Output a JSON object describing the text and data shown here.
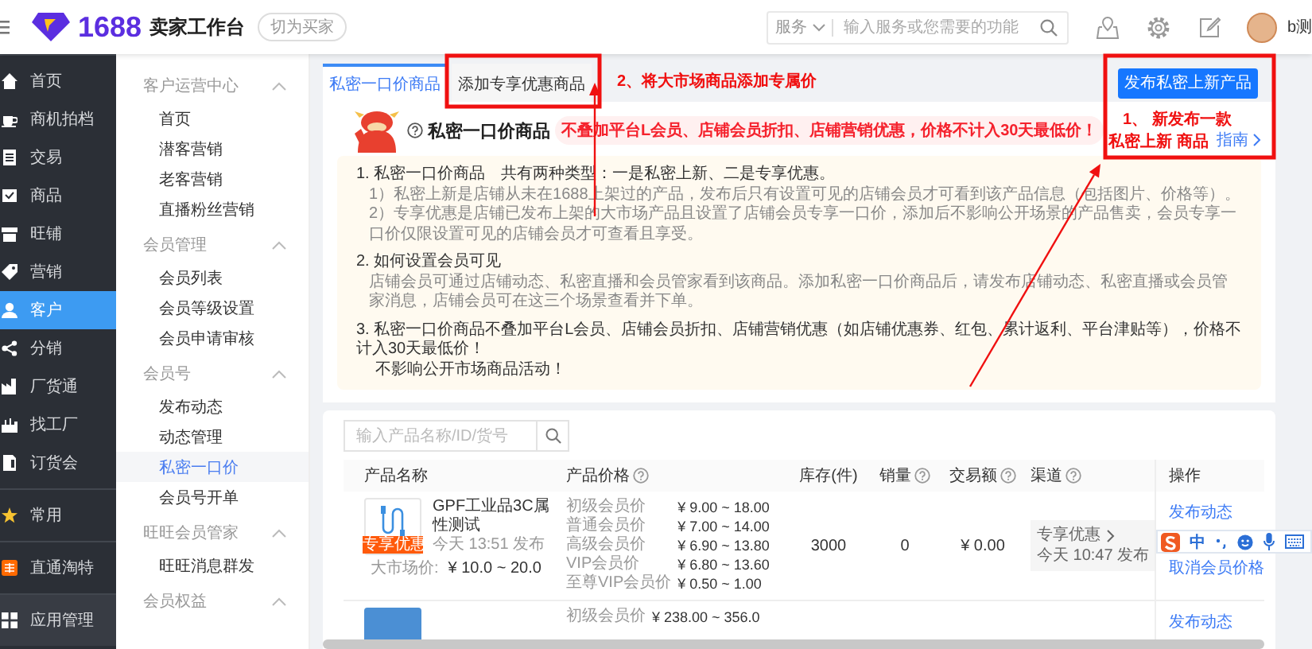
{
  "topbar": {
    "brand": "1688",
    "title": "卖家工作台",
    "switch_button": "切为买家",
    "search": {
      "scope": "服务",
      "placeholder": "输入服务或您需要的功能"
    },
    "user_name": "b测"
  },
  "nav": [
    {
      "items": [
        {
          "label": "首页",
          "selected": false
        },
        {
          "label": "商机拍档",
          "selected": false
        },
        {
          "label": "交易",
          "selected": false
        },
        {
          "label": "商品",
          "selected": false
        },
        {
          "label": "旺铺",
          "selected": false
        },
        {
          "label": "营销",
          "selected": false
        },
        {
          "label": "客户",
          "selected": true
        },
        {
          "label": "分销",
          "selected": false
        },
        {
          "label": "厂货通",
          "selected": false
        },
        {
          "label": "找工厂",
          "selected": false
        },
        {
          "label": "订货会",
          "selected": false
        }
      ]
    },
    {
      "items": [
        {
          "label": "常用",
          "selected": false
        }
      ]
    },
    {
      "items": [
        {
          "label": "直通淘特",
          "selected": false
        }
      ]
    },
    {
      "items": [
        {
          "label": "应用管理",
          "selected": false
        }
      ]
    }
  ],
  "subnav": [
    {
      "title": "客户运营中心",
      "expanded": true,
      "items": [
        {
          "label": "首页",
          "selected": false
        },
        {
          "label": "潜客营销",
          "selected": false
        },
        {
          "label": "老客营销",
          "selected": false
        },
        {
          "label": "直播粉丝营销",
          "selected": false
        }
      ]
    },
    {
      "title": "会员管理",
      "expanded": true,
      "items": [
        {
          "label": "会员列表",
          "selected": false
        },
        {
          "label": "会员等级设置",
          "selected": false
        },
        {
          "label": "会员申请审核",
          "selected": false
        }
      ]
    },
    {
      "title": "会员号",
      "expanded": true,
      "items": [
        {
          "label": "发布动态",
          "selected": false
        },
        {
          "label": "动态管理",
          "selected": false
        },
        {
          "label": "私密一口价",
          "selected": true
        },
        {
          "label": "会员号开单",
          "selected": false
        }
      ]
    },
    {
      "title": "旺旺会员管家",
      "expanded": true,
      "items": [
        {
          "label": "旺旺消息群发",
          "selected": false
        }
      ]
    },
    {
      "title": "会员权益",
      "expanded": true
    }
  ],
  "tabs": [
    {
      "label": "私密一口价商品",
      "selected": true
    },
    {
      "label": "添加专享优惠商品",
      "selected": false
    }
  ],
  "publish_button": "发布私密上新产品",
  "intro": {
    "title": "私密一口价商品",
    "notice": "不叠加平台L会员、店铺会员折扣、店铺营销优惠，价格不计入30天最低价！",
    "guide_link": "指南",
    "sections": [
      {
        "kind": "explain",
        "heading": "1. 私密一口价商品　共有两种类型：一是私密上新、二是专享优惠。",
        "lines": [
          "1）私密上新是店铺从未在1688上架过的产品，发布后只有设置可见的店铺会员才可看到该产品信息（包括图片、价格等）。",
          "2）专享优惠是店铺已发布上架的大市场产品且设置了店铺会员专享一口价，添加后不影响公开场景的产品售卖，会员专享一口价仅限设置可见的店铺会员才可查看且享受。"
        ]
      },
      {
        "kind": "explain",
        "heading": "2. 如何设置会员可见",
        "lines": [
          "店铺会员可通过店铺动态、私密直播和会员管家看到该商品。添加私密一口价商品后，请发布店铺动态、私密直播或会员管家消息，店铺会员可在这三个场景查看并下单。"
        ]
      },
      {
        "kind": "note",
        "heading": "3. 私密一口价商品不叠加平台L会员、店铺会员折扣、店铺营销优惠（如店铺优惠券、红包、累计返利、平台津贴等），价格不计入30天最低价！",
        "lines": [
          "不影响公开市场商品活动！"
        ]
      }
    ]
  },
  "product_search": {
    "placeholder": "输入产品名称/ID/货号"
  },
  "table": {
    "columns": [
      {
        "label": "产品名称",
        "help": false
      },
      {
        "label": "产品价格",
        "help": true
      },
      {
        "label": "库存(件)",
        "help": false
      },
      {
        "label": "销量",
        "help": true
      },
      {
        "label": "交易额",
        "help": true
      },
      {
        "label": "渠道",
        "help": true
      },
      {
        "label": "操作",
        "help": false
      }
    ],
    "rows": [
      {
        "name": "GPF工业品3C属性测试",
        "tag": "专享优惠",
        "published": "今天 13:51 发布",
        "market_label": "大市场价:",
        "market_price": "¥ 10.0 ~ 20.0",
        "prices": [
          {
            "tier": "初级会员价",
            "price": "¥ 9.00 ~ 18.00"
          },
          {
            "tier": "普通会员价",
            "price": "¥ 7.00 ~ 14.00"
          },
          {
            "tier": "高级会员价",
            "price": "¥ 6.90 ~ 13.80"
          },
          {
            "tier": "VIP会员价",
            "price": "¥ 6.80 ~ 13.60"
          },
          {
            "tier": "至尊VIP会员价",
            "price": "¥ 0.50 ~ 1.00"
          }
        ],
        "stock": "3000",
        "sales": "0",
        "amount": "¥ 0.00",
        "channel": {
          "name": "专享优惠",
          "time": "今天 10:47 发布"
        },
        "actions": [
          "发布动态",
          "取消会员价格"
        ]
      },
      {
        "prices": [
          {
            "tier": "初级会员价",
            "price": "¥ 238.00 ~ 356.0"
          }
        ],
        "actions": [
          "发布动态"
        ]
      }
    ]
  },
  "ime_toolbar": {
    "mode": "中"
  },
  "annotations": [
    {
      "text": "2、将大市场商品添加专属价"
    },
    {
      "text": "1、 新发布一款"
    },
    {
      "text": "私密上新  商品"
    }
  ]
}
